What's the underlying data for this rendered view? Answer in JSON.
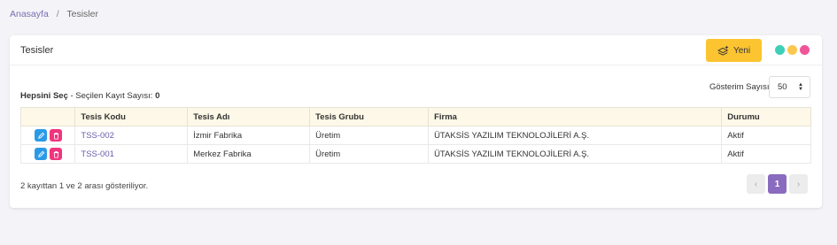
{
  "breadcrumb": {
    "home": "Anasayfa",
    "separator": "/",
    "current": "Tesisler"
  },
  "card": {
    "title": "Tesisler",
    "new_button": "Yeni"
  },
  "theme_dots": [
    "#3ecfb8",
    "#fbc74e",
    "#f0559a"
  ],
  "selection": {
    "select_all": "Hepsini Seç",
    "selected_label": " - Seçilen Kayıt Sayısı: ",
    "selected_count": "0"
  },
  "page_size": {
    "label": "Gösterim Sayısı",
    "value": "50"
  },
  "table": {
    "columns": [
      "",
      "Tesis Kodu",
      "Tesis Adı",
      "Tesis Grubu",
      "Firma",
      "Durumu"
    ],
    "rows": [
      {
        "code": "TSS-002",
        "name": "İzmir Fabrika",
        "group": "Üretim",
        "company": "ÜTAKSİS YAZILIM TEKNOLOJİLERİ A.Ş.",
        "status": "Aktif"
      },
      {
        "code": "TSS-001",
        "name": "Merkez Fabrika",
        "group": "Üretim",
        "company": "ÜTAKSİS YAZILIM TEKNOLOJİLERİ A.Ş.",
        "status": "Aktif"
      }
    ]
  },
  "footer": {
    "info": "2 kayıttan 1 ve 2 arası gösteriliyor."
  },
  "pagination": {
    "prev": "‹",
    "current_page": "1",
    "next": "›"
  },
  "icons": {
    "new": "layers-plus-icon",
    "edit": "pencil-icon",
    "delete": "trash-icon",
    "select_caret": "sort-caret-icon"
  }
}
